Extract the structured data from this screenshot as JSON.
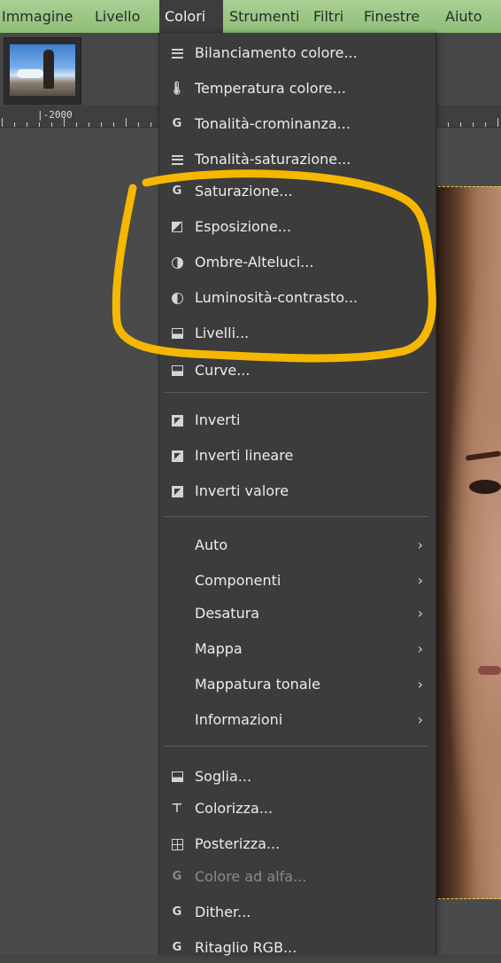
{
  "menubar": {
    "items": [
      "Immagine",
      "Livello",
      "Colori",
      "Strumenti",
      "Filtri",
      "Finestre",
      "Aiuto"
    ],
    "active": "Colori"
  },
  "ruler": {
    "label": "|-2000"
  },
  "menu": {
    "items": [
      {
        "label": "Bilanciamento colore...",
        "icon": "balance-icon"
      },
      {
        "label": "Temperatura colore...",
        "icon": "thermometer-icon"
      },
      {
        "label": "Tonalità-crominanza...",
        "icon": "gegl-g-icon"
      },
      {
        "label": "Tonalità-saturazione...",
        "icon": "hue-saturation-icon"
      },
      {
        "label": "Saturazione...",
        "icon": "gegl-g-icon"
      },
      {
        "label": "Esposizione...",
        "icon": "exposure-icon"
      },
      {
        "label": "Ombre-Alteluci...",
        "icon": "shadows-highlights-icon"
      },
      {
        "label": "Luminosità-contrasto...",
        "icon": "brightness-contrast-icon"
      },
      {
        "label": "Livelli...",
        "icon": "levels-icon"
      },
      {
        "label": "Curve...",
        "icon": "curves-icon"
      },
      {
        "label": "Inverti",
        "icon": "invert-icon"
      },
      {
        "label": "Inverti lineare",
        "icon": "invert-icon"
      },
      {
        "label": "Inverti valore",
        "icon": "invert-icon"
      },
      {
        "label": "Auto",
        "submenu": true
      },
      {
        "label": "Componenti",
        "submenu": true
      },
      {
        "label": "Desatura",
        "submenu": true
      },
      {
        "label": "Mappa",
        "submenu": true
      },
      {
        "label": "Mappatura tonale",
        "submenu": true
      },
      {
        "label": "Informazioni",
        "submenu": true
      },
      {
        "label": "Soglia...",
        "icon": "threshold-icon"
      },
      {
        "label": "Colorizza...",
        "icon": "colorize-icon"
      },
      {
        "label": "Posterizza...",
        "icon": "posterize-icon"
      },
      {
        "label": "Colore ad alfa...",
        "icon": "gegl-g-icon",
        "disabled": true
      },
      {
        "label": "Dither...",
        "icon": "gegl-g-icon"
      },
      {
        "label": "Ritaglio RGB...",
        "icon": "gegl-g-icon"
      }
    ]
  },
  "colors": {
    "menubar": "#9ac985",
    "menu_bg": "#3c3c3c",
    "highlight": "#f5b700"
  }
}
